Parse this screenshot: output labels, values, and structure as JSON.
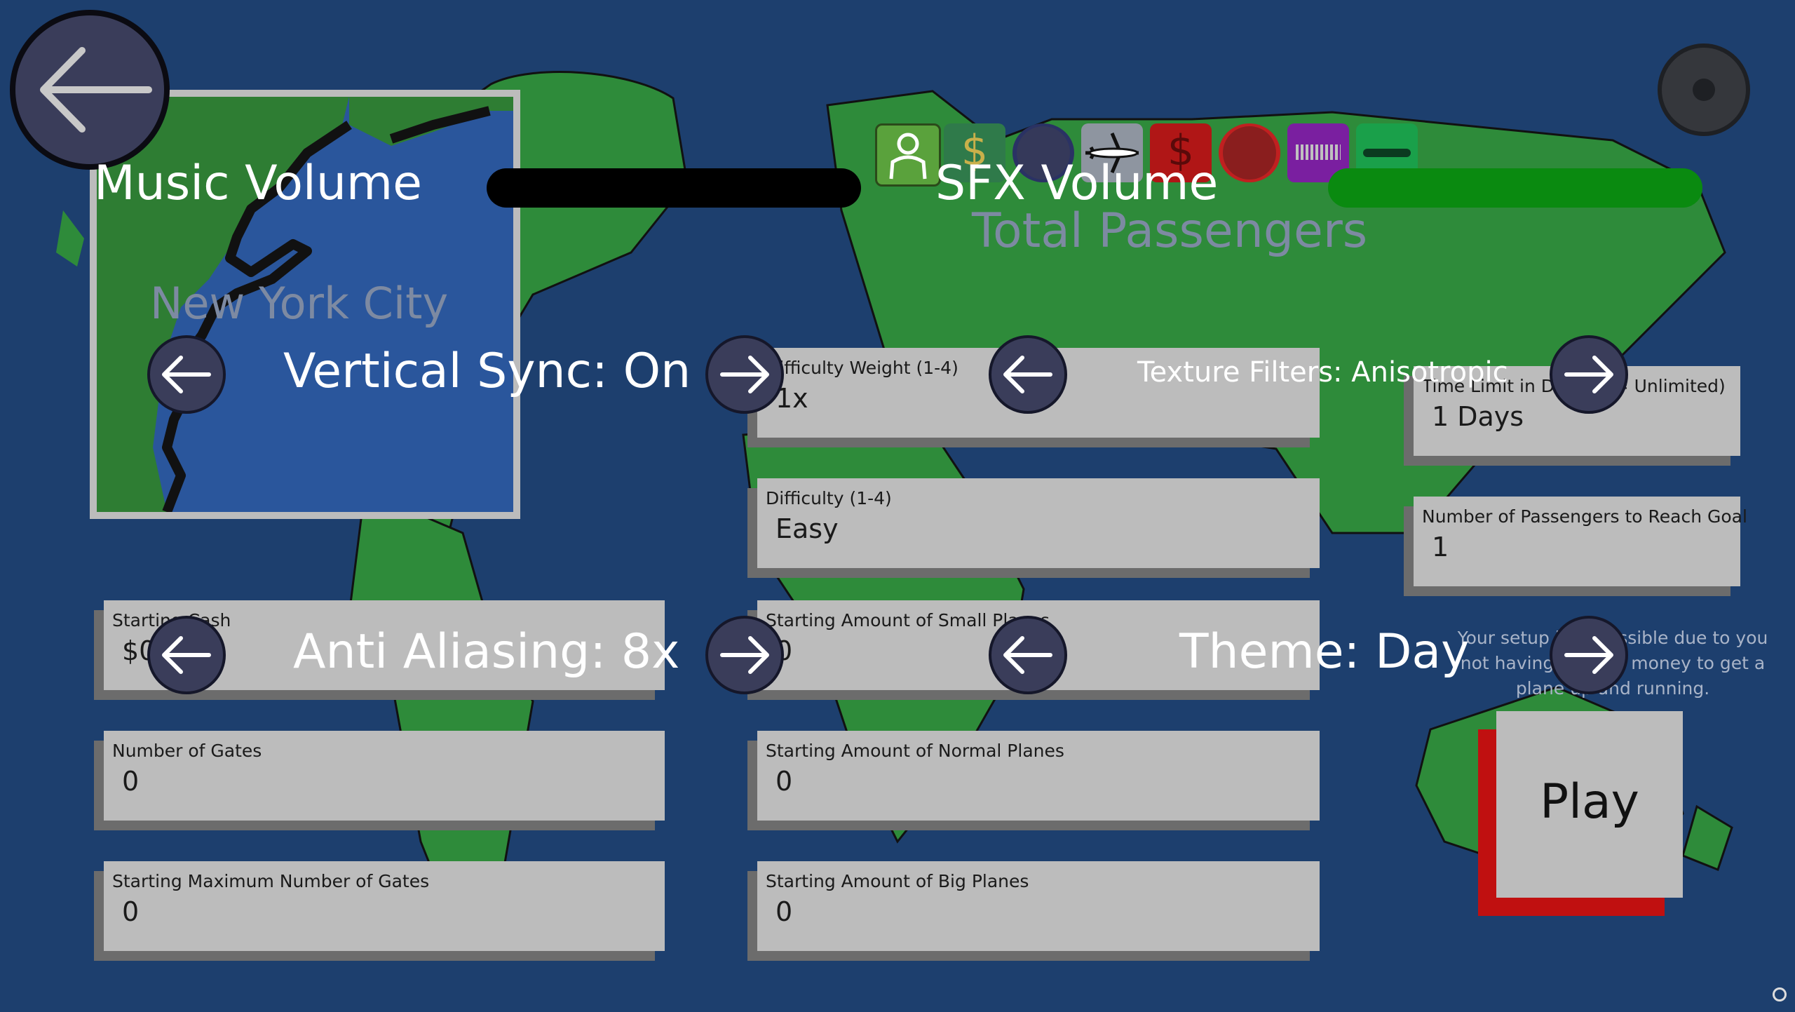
{
  "topbar": {
    "back_icon": "arrow-left-icon",
    "settings_icon": "gear-icon"
  },
  "mode_icons": [
    {
      "icon": "passenger-icon",
      "color": "#5aa23c"
    },
    {
      "icon": "dollar-icon",
      "color": "#2f7a4a"
    },
    {
      "icon": "circle-icon",
      "color": "#35395a"
    },
    {
      "icon": "airplane-icon",
      "color": "#8e95a0"
    },
    {
      "icon": "dollar-icon",
      "color": "#b01616"
    },
    {
      "icon": "circle-icon",
      "color": "#8a1e1e"
    },
    {
      "icon": "barcode-icon",
      "color": "#7a1fa0"
    },
    {
      "icon": "minus-icon",
      "color": "#1aa04a"
    }
  ],
  "goal_title": "Total Passengers",
  "map": {
    "city": "New York City"
  },
  "settings": {
    "music_volume_label": "Music Volume",
    "music_volume": 0.0,
    "sfx_volume_label": "SFX Volume",
    "sfx_volume": 1.0,
    "vsync": "Vertical Sync: On",
    "texture_filters": "Texture Filters: Anisotropic",
    "anti_aliasing": "Anti Aliasing: 8x",
    "theme": "Theme: Day"
  },
  "fields": {
    "difficulty_weight": {
      "label": "Difficulty Weight (1-4)",
      "value": "1x"
    },
    "difficulty": {
      "label": "Difficulty (1-4)",
      "value": "Easy"
    },
    "time_limit": {
      "label": "Time Limit in Days (0 = Unlimited)",
      "value": "1 Days"
    },
    "passengers_goal": {
      "label": "Number of Passengers to Reach Goal",
      "value": "1"
    },
    "starting_cash": {
      "label": "Starting Cash",
      "value": "$0"
    },
    "small_planes": {
      "label": "Starting Amount of Small Planes",
      "value": "0"
    },
    "gates": {
      "label": "Number of Gates",
      "value": "0"
    },
    "normal_planes": {
      "label": "Starting Amount of Normal Planes",
      "value": "0"
    },
    "max_gates": {
      "label": "Starting Maximum Number of Gates",
      "value": "0"
    },
    "big_planes": {
      "label": "Starting Amount of Big Planes",
      "value": "0"
    }
  },
  "warning": "Your setup is impossible due to you not having enough money to get a plane up and running.",
  "play_label": "Play",
  "colors": {
    "background": "#1d3f6e",
    "land": "#2e8b3a",
    "sfx_bar": "#0a8a10",
    "music_bar": "#000000",
    "play_shadow": "#c01010"
  }
}
